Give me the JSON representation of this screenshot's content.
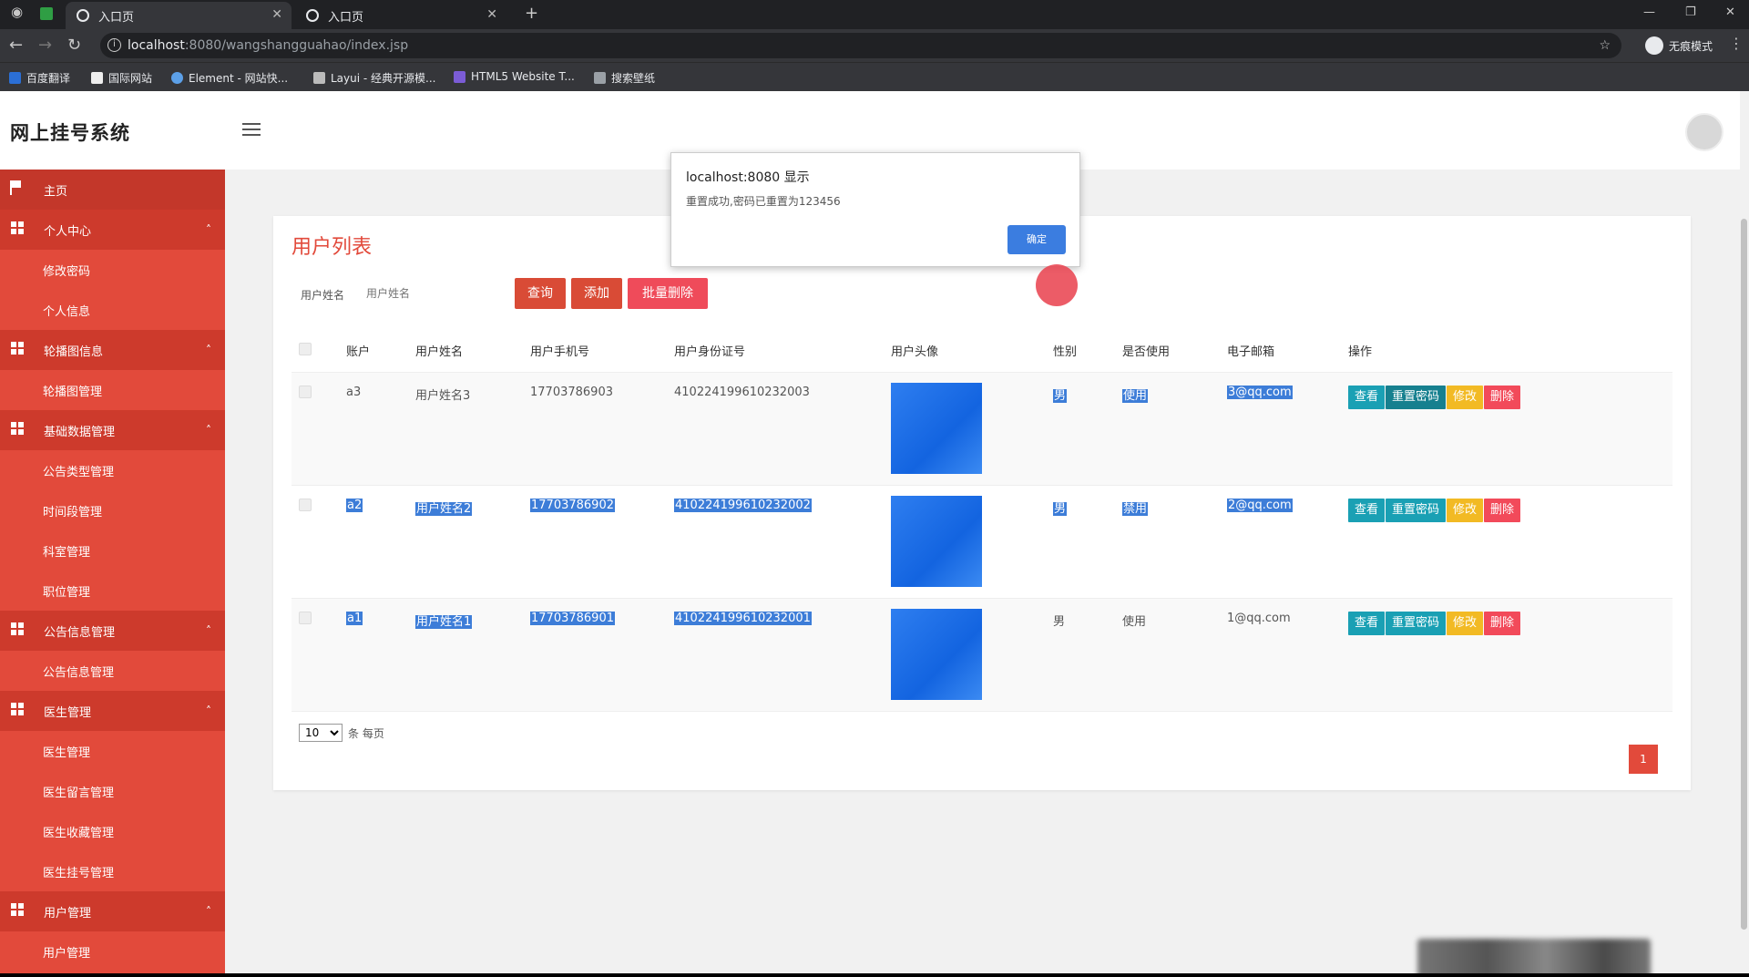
{
  "browser": {
    "tabs": [
      {
        "title": "入口页",
        "active": true
      },
      {
        "title": "入口页",
        "active": false
      }
    ],
    "url_host": "localhost",
    "url_path": ":8080/wangshangguahao/index.jsp",
    "incognito_label": "无痕模式",
    "bookmarks": [
      "百度翻译",
      "国际网站",
      "Element - 网站快...",
      "Layui - 经典开源模...",
      "HTML5 Website T...",
      "搜索壁纸"
    ]
  },
  "app": {
    "title": "网上挂号系统"
  },
  "sidebar": {
    "home": "主页",
    "groups": [
      {
        "label": "个人中心",
        "items": [
          "修改密码",
          "个人信息"
        ]
      },
      {
        "label": "轮播图信息",
        "items": [
          "轮播图管理"
        ]
      },
      {
        "label": "基础数据管理",
        "items": [
          "公告类型管理",
          "时间段管理",
          "科室管理",
          "职位管理"
        ]
      },
      {
        "label": "公告信息管理",
        "items": [
          "公告信息管理"
        ]
      },
      {
        "label": "医生管理",
        "items": [
          "医生管理",
          "医生留言管理",
          "医生收藏管理",
          "医生挂号管理"
        ]
      },
      {
        "label": "用户管理",
        "items": [
          "用户管理"
        ]
      }
    ]
  },
  "main": {
    "title": "用户列表",
    "search_label": "用户姓名",
    "search_placeholder": "用户姓名",
    "buttons": {
      "query": "查询",
      "add": "添加",
      "batch_delete": "批量删除"
    },
    "columns": [
      "账户",
      "用户姓名",
      "用户手机号",
      "用户身份证号",
      "用户头像",
      "性别",
      "是否使用",
      "电子邮箱",
      "操作"
    ],
    "rows": [
      {
        "account": "a3",
        "name": "用户姓名3",
        "phone": "17703786903",
        "idcard": "410224199610232003",
        "gender": "男",
        "status": "使用",
        "email": "3@qq.com"
      },
      {
        "account": "a2",
        "name": "用户姓名2",
        "phone": "17703786902",
        "idcard": "410224199610232002",
        "gender": "男",
        "status": "禁用",
        "email": "2@qq.com"
      },
      {
        "account": "a1",
        "name": "用户姓名1",
        "phone": "17703786901",
        "idcard": "410224199610232001",
        "gender": "男",
        "status": "使用",
        "email": "1@qq.com"
      }
    ],
    "actions": {
      "view": "查看",
      "reset": "重置密码",
      "edit": "修改",
      "delete": "删除"
    },
    "page_size": "10",
    "page_size_suffix": "条 每页",
    "current_page": "1"
  },
  "dialog": {
    "title": "localhost:8080 显示",
    "message": "重置成功,密码已重置为123456",
    "ok": "确定"
  }
}
